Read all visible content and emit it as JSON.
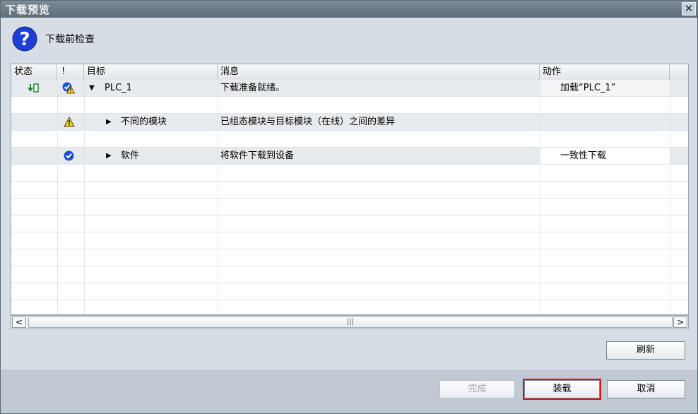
{
  "window": {
    "title": "下载预览",
    "close_glyph": "✕"
  },
  "header": {
    "icon": "question-icon",
    "text": "下载前检查"
  },
  "table": {
    "columns": [
      "状态",
      "!",
      "目标",
      "消息",
      "动作"
    ],
    "rows": [
      {
        "status_icon": "download-status-icon",
        "warn_icon": "check-warning-icon",
        "expander": "▼",
        "target": "PLC_1",
        "message": "下载准备就绪。",
        "action": "加载“PLC_1”"
      },
      {
        "status_icon": "",
        "warn_icon": "warning-icon",
        "expander": "▶",
        "target": "不同的模块",
        "message": "已组态模块与目标模块（在线）之间的差异",
        "action": ""
      },
      {
        "status_icon": "",
        "warn_icon": "check-icon",
        "expander": "▶",
        "target": "软件",
        "message": "将软件下载到设备",
        "action": "一致性下载"
      }
    ]
  },
  "scrollbar": {
    "left_glyph": "<",
    "right_glyph": ">",
    "thumb_glyph": "|||"
  },
  "buttons": {
    "refresh": "刷新",
    "finish": "完成",
    "load": "装载",
    "cancel": "取消"
  },
  "colors": {
    "highlight": "#e01010",
    "warning": "#f2d400",
    "check": "#1b4fd6"
  }
}
